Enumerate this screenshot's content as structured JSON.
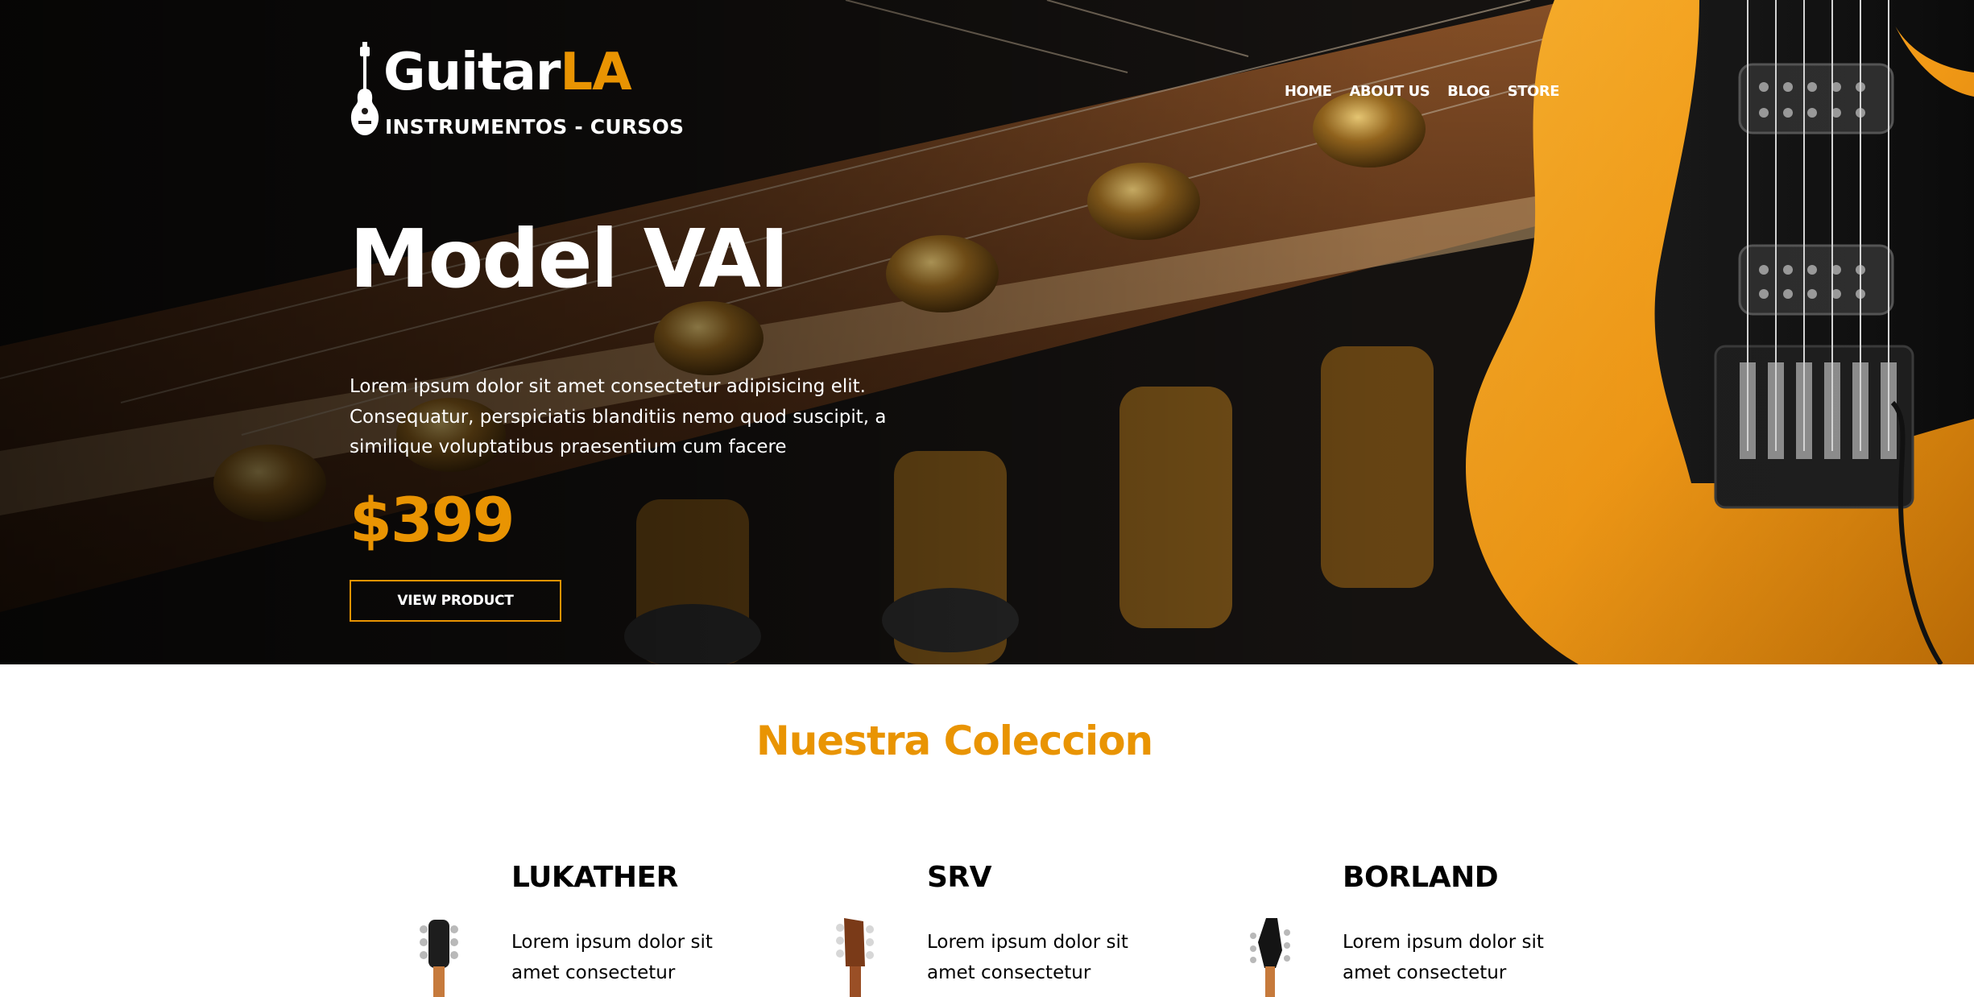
{
  "header": {
    "logo": {
      "word": "Guitar",
      "accent": "LA",
      "tagline": "INSTRUMENTOS - CURSOS"
    },
    "nav": [
      {
        "label": "HOME"
      },
      {
        "label": "ABOUT US"
      },
      {
        "label": "BLOG"
      },
      {
        "label": "STORE"
      }
    ]
  },
  "hero": {
    "title": "Model VAI",
    "description": "Lorem ipsum dolor sit amet consectetur adipisicing elit. Consequatur, perspiciatis blanditiis nemo quod suscipit, a similique voluptatibus praesentium cum facere",
    "price": "$399",
    "button_label": "VIEW PRODUCT"
  },
  "collection": {
    "title": "Nuestra Coleccion",
    "products": [
      {
        "name": "LUKATHER",
        "description": "Lorem ipsum dolor sit amet consectetur",
        "image_icon": "guitar-lukather-icon"
      },
      {
        "name": "SRV",
        "description": "Lorem ipsum dolor sit amet consectetur",
        "image_icon": "guitar-srv-icon"
      },
      {
        "name": "BORLAND",
        "description": "Lorem ipsum dolor sit amet consectetur",
        "image_icon": "guitar-borland-icon"
      }
    ]
  },
  "colors": {
    "accent": "#e99402",
    "hero_text": "#ffffff",
    "body_text": "#000000",
    "guitar_body": "#f39a16"
  }
}
